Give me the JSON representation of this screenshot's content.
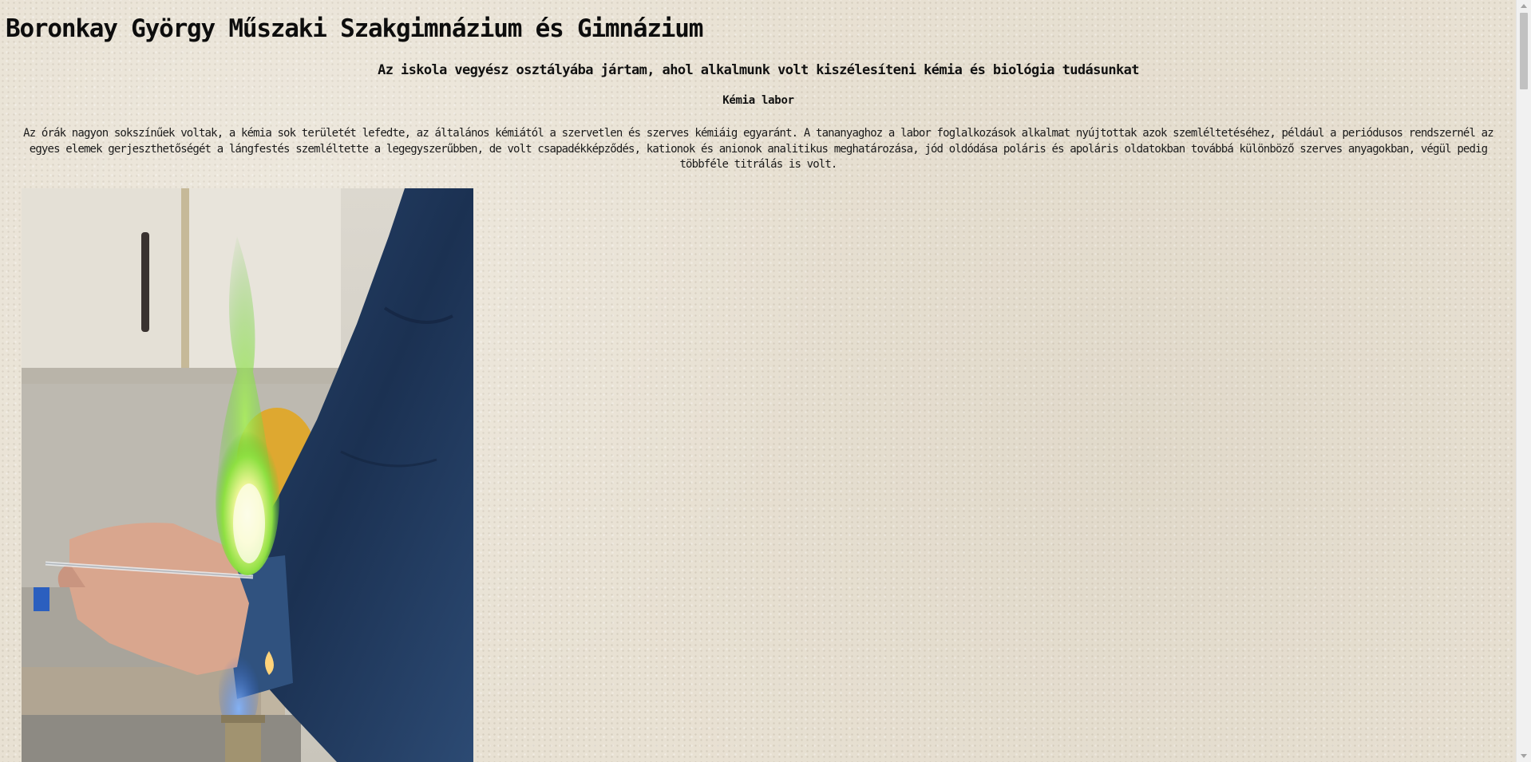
{
  "header": {
    "title": "Boronkay György Műszaki Szakgimnázium és Gimnázium"
  },
  "intro": {
    "subtitle": "Az iskola vegyész osztályába jártam, ahol alkalmunk volt kiszélesíteni kémia és biológia tudásunkat"
  },
  "section": {
    "title": "Kémia labor",
    "paragraph": "Az órák nagyon sokszínűek voltak, a kémia sok területét lefedte, az általános kémiától a szervetlen és szerves kémiáig egyaránt. A tananyaghoz a labor foglalkozások alkalmat nyújtottak azok szemléltetéséhez, például a periódusos rendszernél az egyes elemek gerjeszthetőségét a lángfestés szemléltette a legegyszerűbben, de volt csapadékképződés, kationok és anionok analitikus meghatározása, jód oldódása poláris és apoláris oldatokban továbbá különböző szerves anyagokban, végül pedig többféle titrálás is volt."
  },
  "colors": {
    "background": "#e8e1d3",
    "flame_green": "#7ddc3a",
    "jacket_denim": "#1f3556"
  },
  "icons": {
    "scroll_up": "chevron-up-icon",
    "scroll_down": "chevron-down-icon"
  }
}
